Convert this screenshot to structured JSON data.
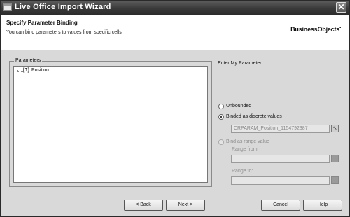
{
  "window": {
    "title": "Live Office Import Wizard",
    "close_label": "✕"
  },
  "header": {
    "title": "Specify Parameter Binding",
    "subtitle": "You can bind parameters to values from specific cells",
    "brand": "BusinessObjects",
    "brand_mark": "•"
  },
  "parameters": {
    "legend": "Parameters",
    "items": [
      {
        "icon": "[?]",
        "label": "Position"
      }
    ]
  },
  "binding": {
    "heading": "Enter My Parameter:",
    "unbounded_label": "Unbounded",
    "discrete_label": "Binded as discrete values",
    "discrete_value": "CRPARAM_Position_1154792387",
    "range_label": "Bind as range value",
    "range_from_label": "Range from:",
    "range_to_label": "Range to:",
    "selected": "discrete"
  },
  "footer": {
    "back_label": "< Back",
    "next_label": "Next >",
    "cancel_label": "Cancel",
    "help_label": "Help"
  }
}
